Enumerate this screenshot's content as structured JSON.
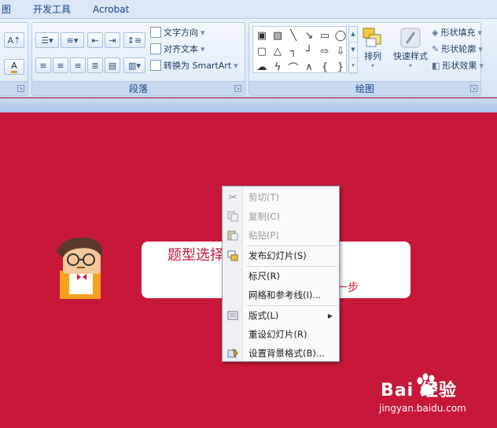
{
  "menubar": {
    "tabs": [
      "图",
      "开发工具",
      "Acrobat"
    ]
  },
  "ribbon": {
    "paragraph_group": {
      "title": "段落",
      "text_direction": "文字方向",
      "align_text": "对齐文本",
      "convert_smartart": "转换为 SmartArt"
    },
    "drawing_group": {
      "title": "绘图",
      "arrange": "排列",
      "quick_styles": "快速样式",
      "shape_fill": "形状填充",
      "shape_outline": "形状轮廓",
      "shape_effects": "形状效果"
    }
  },
  "slide": {
    "title_text": "题型选择",
    "subtitle_text": "一步"
  },
  "context_menu": {
    "items": [
      {
        "label": "剪切(T)",
        "icon": "scissors-icon",
        "enabled": false
      },
      {
        "label": "复制(C)",
        "icon": "copy-icon",
        "enabled": false
      },
      {
        "label": "粘贴(P)",
        "icon": "paste-icon",
        "enabled": false
      },
      {
        "label": "发布幻灯片(S)",
        "icon": "publish-slides-icon",
        "enabled": true
      },
      {
        "label": "标尺(R)",
        "icon": "",
        "enabled": true
      },
      {
        "label": "网格和参考线(I)...",
        "icon": "",
        "enabled": true
      },
      {
        "label": "版式(L)",
        "icon": "layout-icon",
        "enabled": true,
        "submenu": true
      },
      {
        "label": "重设幻灯片(R)",
        "icon": "",
        "enabled": true
      },
      {
        "label": "设置背景格式(B)...",
        "icon": "format-background-icon",
        "enabled": true
      }
    ]
  },
  "watermark": {
    "logo_text": "Bai  经验",
    "url": "jingyan.baidu.com"
  },
  "colors": {
    "slide_background": "#c8183a",
    "ribbon_text": "#15428b"
  }
}
